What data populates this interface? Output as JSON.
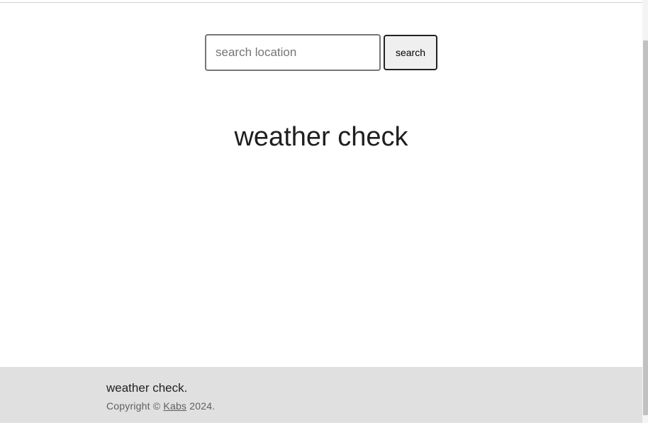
{
  "search": {
    "placeholder": "search location",
    "value": "",
    "button_label": "search"
  },
  "main": {
    "title": "weather check"
  },
  "footer": {
    "brand": "weather check.",
    "copyright_prefix": "Copyright ©",
    "author_link": "Kabs",
    "year_suffix": "2024."
  },
  "colors": {
    "footer_background": "#e0e0e0",
    "button_background": "#efefef",
    "title_text": "#1f1f1f"
  }
}
